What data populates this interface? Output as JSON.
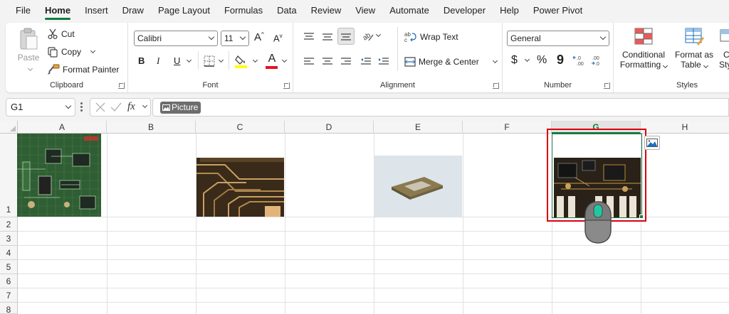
{
  "menu": {
    "items": [
      "File",
      "Home",
      "Insert",
      "Draw",
      "Page Layout",
      "Formulas",
      "Data",
      "Review",
      "View",
      "Automate",
      "Developer",
      "Help",
      "Power Pivot"
    ],
    "active": "Home"
  },
  "ribbon": {
    "clipboard": {
      "label": "Clipboard",
      "paste": "Paste",
      "cut": "Cut",
      "copy": "Copy",
      "format_painter": "Format Painter"
    },
    "font": {
      "label": "Font",
      "font_name": "Calibri",
      "font_size": "11",
      "bold": "B",
      "italic": "I",
      "underline": "U",
      "highlight_color": "#ffff00",
      "font_color": "#e81123"
    },
    "alignment": {
      "label": "Alignment",
      "wrap_text": "Wrap Text",
      "merge_center": "Merge & Center"
    },
    "number": {
      "label": "Number",
      "format": "General",
      "currency": "$",
      "percent": "%",
      "comma": "9"
    },
    "styles": {
      "label": "Styles",
      "conditional_line1": "Conditional",
      "conditional_line2": "Formatting",
      "format_table_line1": "Format as",
      "format_table_line2": "Table",
      "cell_styles_line1": "C",
      "cell_styles_line2": "Styl"
    }
  },
  "formula_bar": {
    "name_box": "G1",
    "fx": "fx",
    "content_chip": "Picture"
  },
  "grid": {
    "columns": [
      "A",
      "B",
      "C",
      "D",
      "E",
      "F",
      "G",
      "H"
    ],
    "selected_column": "G",
    "rows": [
      "1",
      "2",
      "3",
      "4",
      "5",
      "6",
      "7",
      "8"
    ]
  },
  "colors": {
    "accent": "#107c41",
    "highlight_box": "#d9000d",
    "board_green": "#2f5d34",
    "board_brown": "#5a4325"
  }
}
